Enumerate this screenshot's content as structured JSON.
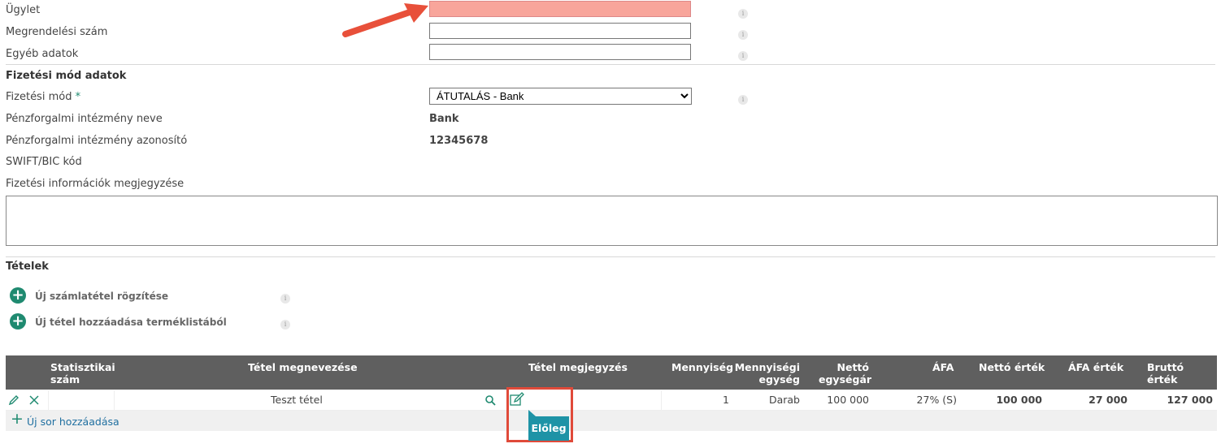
{
  "fields": [
    {
      "label": "Ügylet",
      "value": ""
    },
    {
      "label": "Megrendelési szám",
      "value": ""
    },
    {
      "label": "Egyéb adatok",
      "value": ""
    }
  ],
  "payment": {
    "section_title": "Fizetési mód adatok",
    "mode_label": "Fizetési mód",
    "required_mark": "*",
    "mode_value": "ÁTUTALÁS - Bank",
    "institution_name_label": "Pénzforgalmi intézmény neve",
    "institution_name_value": "Bank",
    "institution_id_label": "Pénzforgalmi intézmény azonosító",
    "institution_id_value": "12345678",
    "swift_label": "SWIFT/BIC kód",
    "note_label": "Fizetési információk megjegyzése",
    "note_value": ""
  },
  "items": {
    "section_title": "Tételek",
    "add_manual_label": "Új számlatétel rögzítése",
    "add_from_list_label": "Új tétel hozzáadása terméklistából",
    "columns": {
      "stat": "Statisztikai szám",
      "name": "Tétel megnevezése",
      "note": "Tétel megjegyzés",
      "qty": "Mennyiség",
      "unit": "Mennyiségi egység",
      "unit_price": "Nettó egységár",
      "vat": "ÁFA",
      "net": "Nettó érték",
      "vat_value": "ÁFA érték",
      "gross": "Bruttó érték"
    },
    "rows": [
      {
        "stat": "",
        "name": "Teszt tétel",
        "qty": "1",
        "unit": "Darab",
        "unit_price": "100 000",
        "vat": "27% (S)",
        "net": "100 000",
        "vat_value": "27 000",
        "gross": "127 000"
      }
    ],
    "add_row_label": "Új sor hozzáadása",
    "tooltip": "Előleg"
  },
  "colors": {
    "highlight_input": "#f8a59b",
    "arrow": "#e8503a",
    "accent": "#1f8a70",
    "header_bg": "#5f5f5f"
  }
}
